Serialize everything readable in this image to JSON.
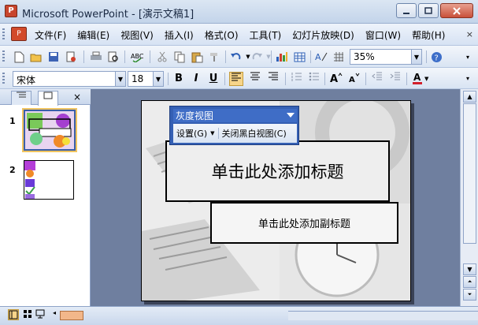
{
  "window": {
    "title": "Microsoft PowerPoint - [演示文稿1]",
    "app_icon": "P"
  },
  "menu": {
    "items": [
      "文件(F)",
      "编辑(E)",
      "视图(V)",
      "插入(I)",
      "格式(O)",
      "工具(T)",
      "幻灯片放映(D)",
      "窗口(W)",
      "帮助(H)"
    ],
    "close_glyph": "×"
  },
  "toolbar": {
    "zoom": "35%",
    "font": "宋体",
    "font_size": "18",
    "bold": "B",
    "italic": "I",
    "underline": "U"
  },
  "grayscale_toolbar": {
    "mode": "灰度视图",
    "settings": "设置(G)",
    "close": "关闭黑白视图(C)"
  },
  "slides": [
    {
      "number": "1"
    },
    {
      "number": "2"
    }
  ],
  "slide": {
    "title_placeholder": "单击此处添加标题",
    "subtitle_placeholder": "单击此处添加副标题"
  },
  "colors": {
    "grayscale_toolbar_bg": "#3560b4",
    "selected_format_button": "#f7d58a"
  }
}
